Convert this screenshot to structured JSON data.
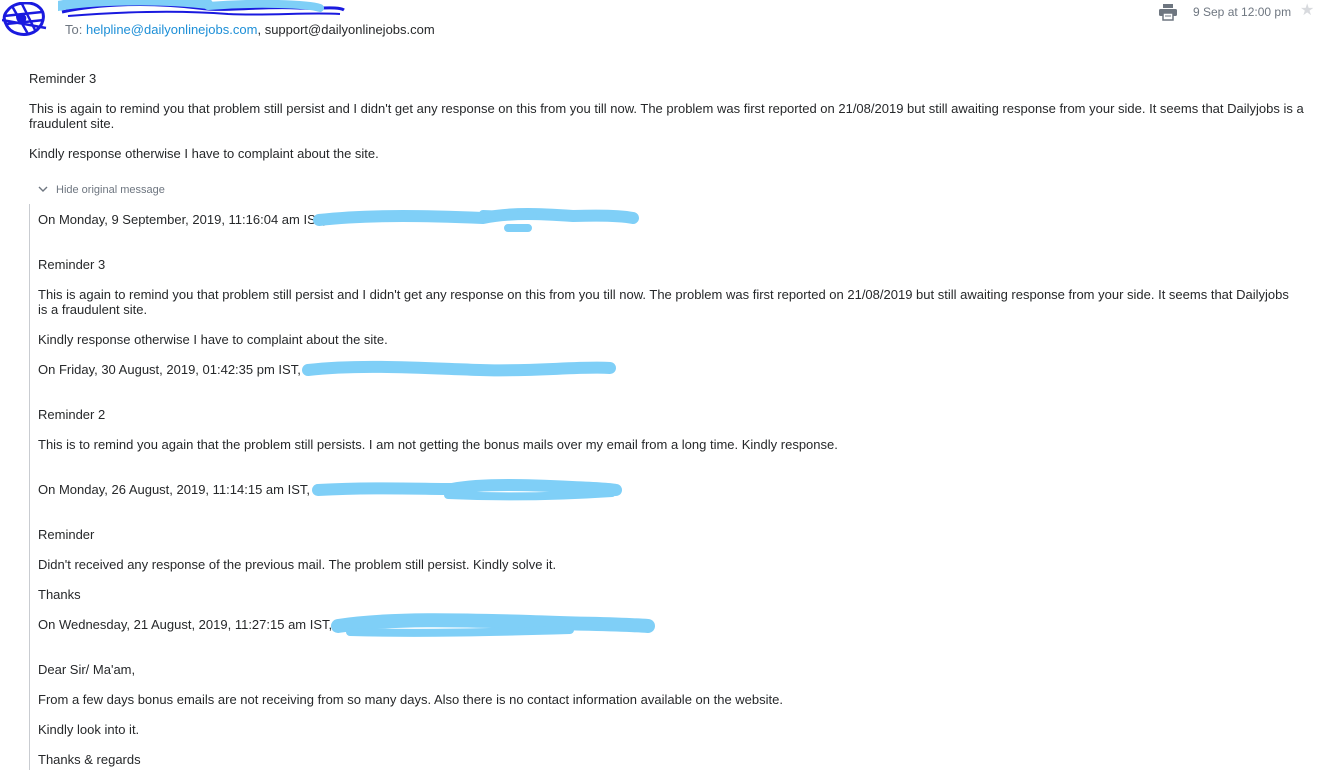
{
  "header": {
    "to_label": "To:",
    "recipients": [
      "helpline@dailyonlinejobs.com",
      "support@dailyonlinejobs.com"
    ],
    "recipient_separator": ",",
    "date": "9 Sep at 12:00 pm",
    "print_icon": "print-icon",
    "star_icon": "star-icon"
  },
  "message": {
    "title": "Reminder 3",
    "paragraph1": "This is again to remind you that problem still persist and I didn't get any response on this from you till now. The problem was first reported on 21/08/2019 but still awaiting response from your side. It seems that Dailyjobs is a fraudulent site.",
    "paragraph2": "Kindly response otherwise I have to complaint about the site."
  },
  "toggle": {
    "label": "Hide original message",
    "icon": "chevron-down-icon"
  },
  "quoted": {
    "header1": "On Monday, 9 September, 2019, 11:16:04 am IST,",
    "r3_title": "Reminder 3",
    "r3_p1": "This is again to remind you that problem still persist and I didn't get any response on this from you till now. The problem was first reported on 21/08/2019 but still awaiting response from your side. It seems that Dailyjobs is a fraudulent site.",
    "r3_p2": "Kindly response otherwise I have to complaint about the site.",
    "header2": "On Friday, 30 August, 2019, 01:42:35 pm IST,",
    "r2_title": "Reminder 2",
    "r2_p1": "This is to remind you again that the problem still persists. I am not getting the bonus mails over my email from a long time. Kindly response.",
    "header3": "On Monday, 26 August, 2019, 11:14:15 am IST,",
    "r1_title": "Reminder",
    "r1_p1": "Didn't received any response of the previous mail. The problem still persist. Kindly solve it.",
    "r1_p2": "Thanks",
    "header4": "On Wednesday, 21 August, 2019, 11:27:15 am IST,",
    "orig_greeting": "Dear Sir/ Ma'am,",
    "orig_p1": "From a few days bonus emails are not receiving from so many days. Also there is no contact information available on the website.",
    "orig_p2": "Kindly look into it.",
    "orig_closing": "Thanks & regards"
  },
  "colors": {
    "redaction": "#7fcff7",
    "sender_redaction": "#1a1adf",
    "link": "#1d8fd7",
    "muted": "#6e7680",
    "text": "#26282a"
  }
}
